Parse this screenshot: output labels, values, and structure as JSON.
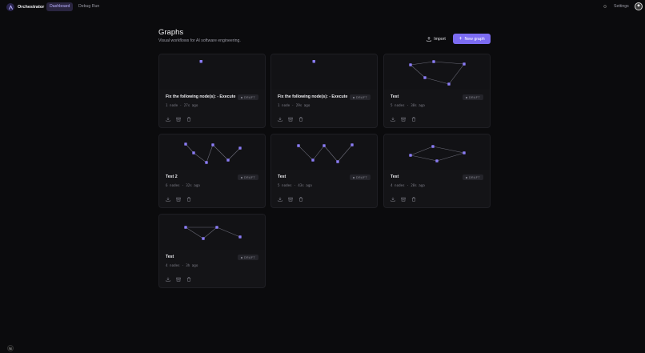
{
  "app": {
    "brand": "Orchestrator",
    "tabs": [
      {
        "label": "Dashboard",
        "active": true
      },
      {
        "label": "Debug Run",
        "active": false
      }
    ],
    "settings_label": "Settings"
  },
  "header": {
    "title": "Graphs",
    "subtitle": "Visual workflows for AI software engineering.",
    "import_label": "Import",
    "new_graph_label": "New graph"
  },
  "colors": {
    "accent": "#7c6cf2",
    "node": "#8b7cf6",
    "edge": "#6b6b78"
  },
  "cards": [
    {
      "title": "Fix the following node(s): - Execute",
      "badge": "DRAFT",
      "meta": "1 node · 27s ago"
    },
    {
      "title": "Fix the following node(s): - Execute",
      "badge": "DRAFT",
      "meta": "1 node · 29s ago"
    },
    {
      "title": "Test",
      "badge": "DRAFT",
      "meta": "5 nodes · 38s ago"
    },
    {
      "title": "Test 2",
      "badge": "DRAFT",
      "meta": "6 nodes · 32s ago"
    },
    {
      "title": "Test",
      "badge": "DRAFT",
      "meta": "5 nodes · 43s ago"
    },
    {
      "title": "Test",
      "badge": "DRAFT",
      "meta": "4 nodes · 28s ago"
    },
    {
      "title": "Test",
      "badge": "DRAFT",
      "meta": "4 nodes · 3h ago"
    }
  ],
  "footer": {
    "badge": "N"
  }
}
